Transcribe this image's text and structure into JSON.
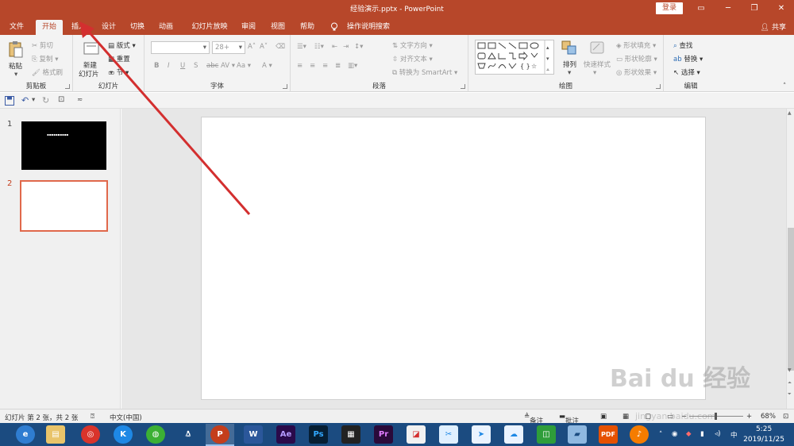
{
  "window": {
    "title": "经验演示.pptx  -  PowerPoint",
    "login_label": "登录",
    "share_label": "共享"
  },
  "tabs": [
    {
      "label": "文件"
    },
    {
      "label": "开始",
      "active": true
    },
    {
      "label": "插入"
    },
    {
      "label": "设计"
    },
    {
      "label": "切换"
    },
    {
      "label": "动画"
    },
    {
      "label": "幻灯片放映"
    },
    {
      "label": "审阅"
    },
    {
      "label": "视图"
    },
    {
      "label": "帮助"
    },
    {
      "label": "操作说明搜索"
    }
  ],
  "ribbon": {
    "clipboard": {
      "label": "剪贴板",
      "paste": "粘贴",
      "cut": "剪切",
      "copy": "复制",
      "format_painter": "格式刷"
    },
    "slides": {
      "label": "幻灯片",
      "new_slide_line1": "新建",
      "new_slide_line2": "幻灯片",
      "layout": "版式",
      "reset": "重置",
      "section": "节"
    },
    "font": {
      "label": "字体",
      "font_name": "",
      "font_size": "28+",
      "bold": "B",
      "italic": "I",
      "underline": "U",
      "shadow": "S",
      "strikethrough": "abc",
      "spacing": "AV",
      "case": "Aa",
      "font_color": "A"
    },
    "paragraph": {
      "label": "段落",
      "text_direction": "文字方向",
      "align_text": "对齐文本",
      "smartart": "转换为 SmartArt"
    },
    "drawing": {
      "label": "绘图",
      "arrange": "排列",
      "quick_styles": "快速样式",
      "shape_fill": "形状填充",
      "shape_outline": "形状轮廓",
      "shape_effects": "形状效果"
    },
    "editing": {
      "label": "编辑",
      "find": "查找",
      "replace": "替换",
      "select": "选择"
    }
  },
  "slides": [
    {
      "number": "1",
      "title_text": "▪▪▪▪▪▪▪▪▪▪",
      "background": "#000000"
    },
    {
      "number": "2",
      "background": "#ffffff",
      "selected": true
    }
  ],
  "status": {
    "slide_info": "幻灯片 第 2 张，共 2 张",
    "language": "中文(中国)",
    "notes": "备注",
    "comments": "批注",
    "zoom": "68%"
  },
  "taskbar": {
    "apps": [
      "browser",
      "file-explorer",
      "netease-music",
      "kuaikan",
      "wechat",
      "qq",
      "powerpoint",
      "word",
      "after-effects",
      "photoshop",
      "video-editor",
      "premiere",
      "picture-app",
      "snipaste",
      "feishu",
      "baidu-netdisk",
      "wechat-work",
      "notepad",
      "pdf-reader",
      "music-player"
    ],
    "time": "5:25",
    "date": "2019/11/25"
  },
  "watermark": {
    "text": "Bai du 经验",
    "url": "jingyan.baidu.com"
  },
  "colors": {
    "accent": "#b7472a",
    "selected_slide_border": "#e0684b",
    "arrow": "#d32f2f",
    "taskbar": "#1b4b80"
  }
}
